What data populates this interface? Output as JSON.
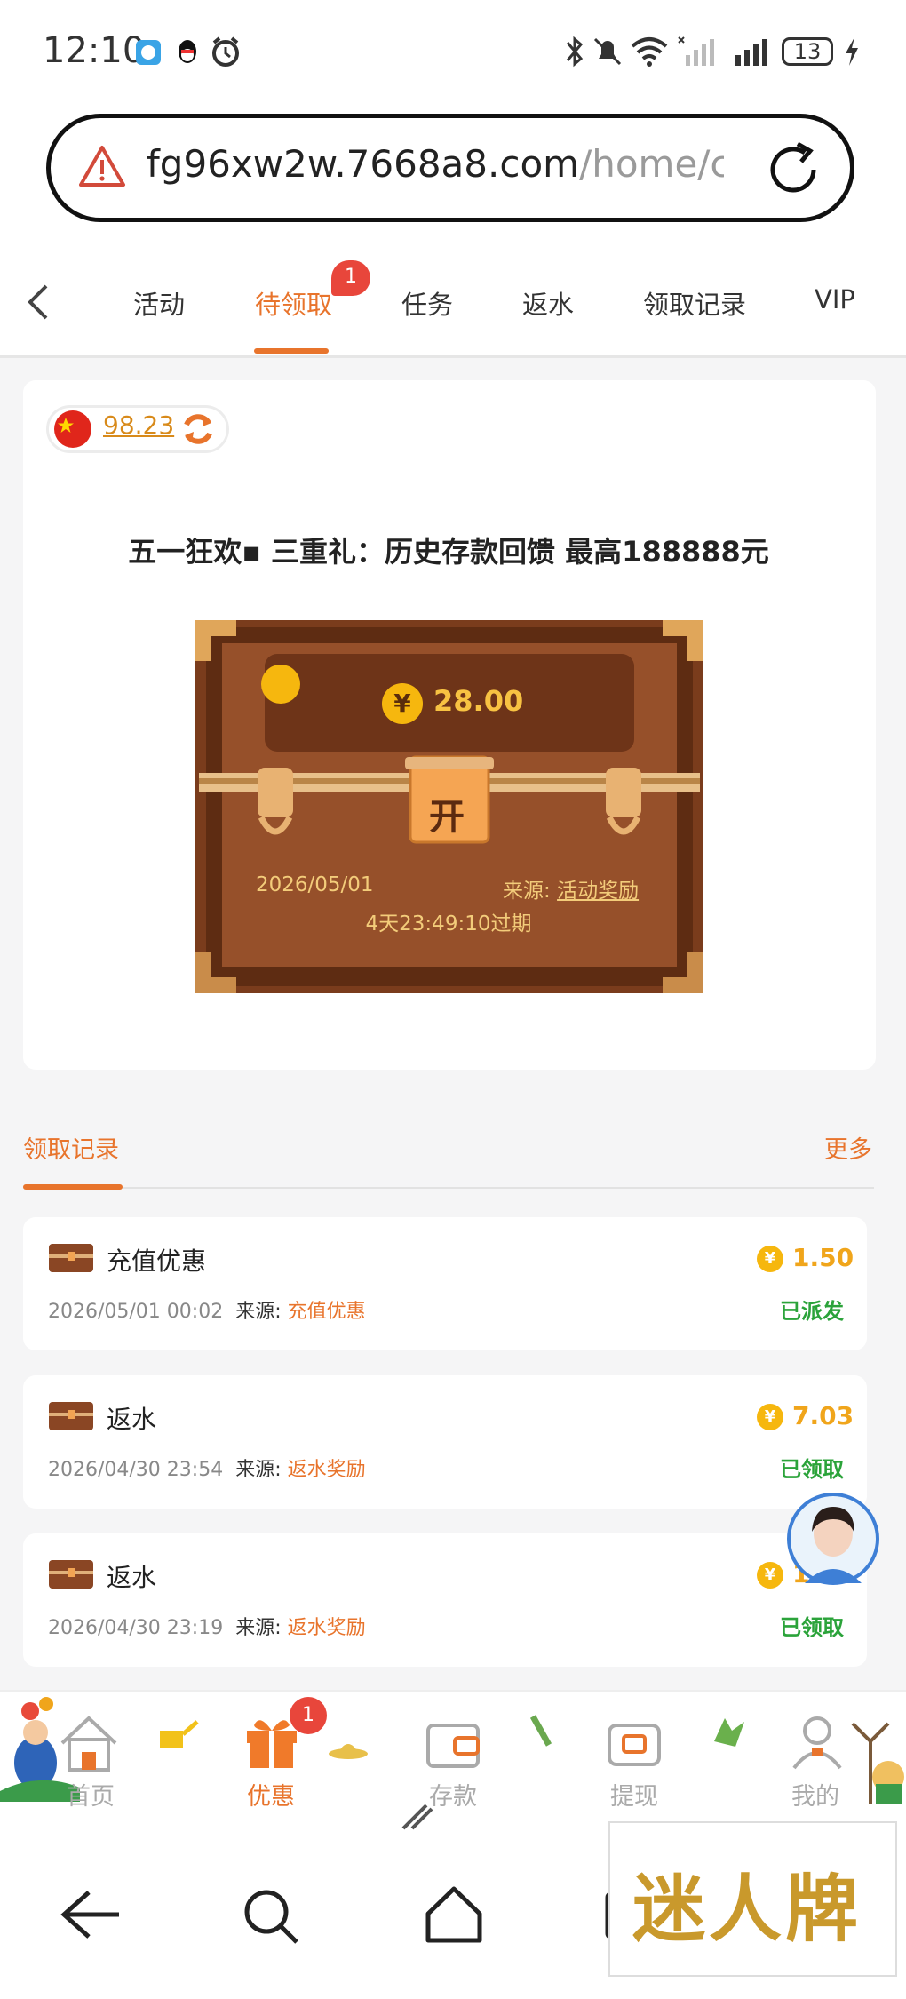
{
  "status_bar": {
    "time": "12:10",
    "battery": "13"
  },
  "browser": {
    "url_host": "fg96xw2w.7668a8.com",
    "url_path": "/home/canl"
  },
  "tabs": {
    "items": [
      "活动",
      "待领取",
      "任务",
      "返水",
      "领取记录",
      "VIP"
    ],
    "active": "待领取",
    "badge": "1"
  },
  "card": {
    "balance": "98.23",
    "headline": "五一狂欢▪ 三重礼：历史存款回馈 最高188888元",
    "chest": {
      "amount": "28.00",
      "open_label": "开",
      "date": "2026/05/01",
      "source_label": "来源:",
      "source_value": "活动奖励",
      "expire": "4天23:49:10过期"
    }
  },
  "records": {
    "title": "领取记录",
    "more": "更多",
    "items": [
      {
        "name": "充值优惠",
        "time": "2026/05/01 00:02",
        "source_label": "来源:",
        "source": "充值优惠",
        "amount": "1.50",
        "status": "已派发"
      },
      {
        "name": "返水",
        "time": "2026/04/30 23:54",
        "source_label": "来源:",
        "source": "返水奖励",
        "amount": "7.03",
        "status": "已领取"
      },
      {
        "name": "返水",
        "time": "2026/04/30 23:19",
        "source_label": "来源:",
        "source": "返水奖励",
        "amount": "1.5",
        "status": "已领取"
      }
    ]
  },
  "bottom_nav": {
    "items": [
      "首页",
      "优惠",
      "存款",
      "提现",
      "我的"
    ],
    "active": "优惠",
    "badge": "1"
  },
  "watermark": "迷人牌",
  "colors": {
    "accent": "#e8742c",
    "gold": "#f0a51b",
    "success": "#2ba33a",
    "badge": "#e8463b"
  }
}
